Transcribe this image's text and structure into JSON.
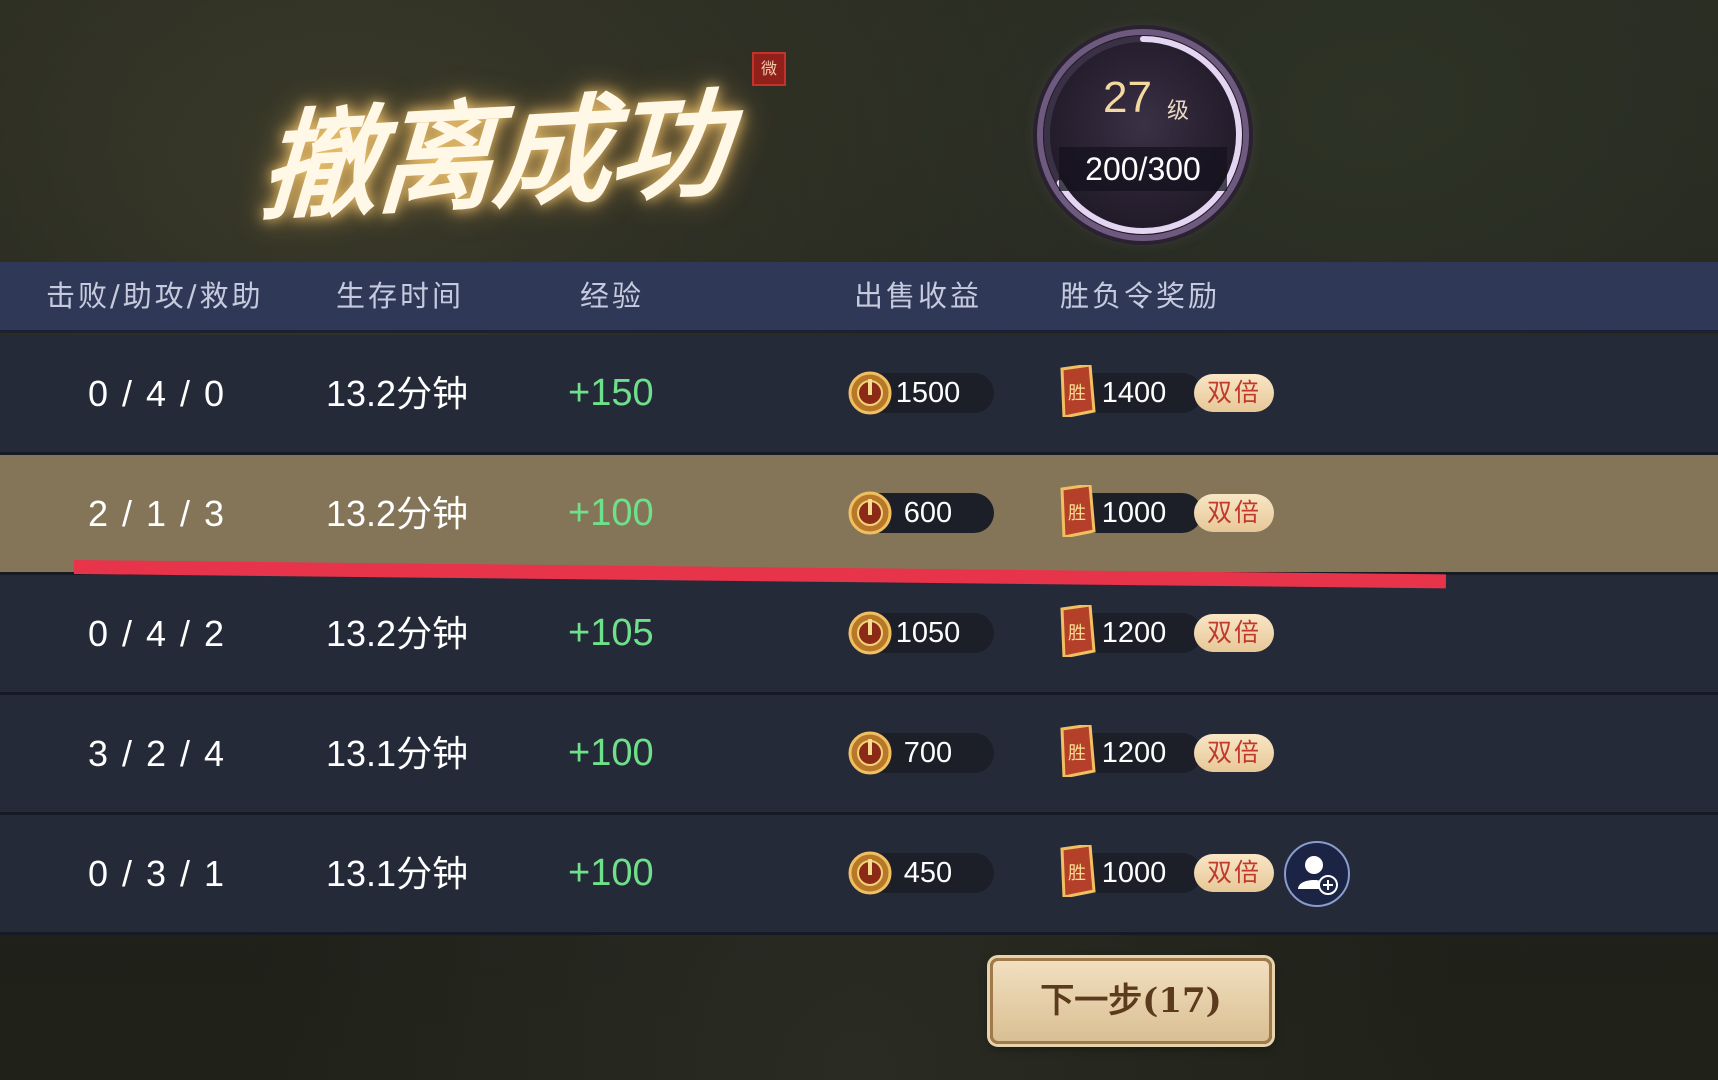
{
  "title": {
    "text": "撤离成功",
    "seal": "微"
  },
  "level": {
    "value": "27",
    "unit": "级",
    "exp": "200/300",
    "exp_fraction": 0.6667
  },
  "table": {
    "headers": [
      "击败/助攻/救助",
      "生存时间",
      "经验",
      "出售收益",
      "胜负令奖励"
    ],
    "rows": [
      {
        "kda": "0 / 4 / 0",
        "time": "13.2分钟",
        "exp": "+150",
        "gold": "1500",
        "ticket": "1400",
        "double": "双倍",
        "highlight": false,
        "add_friend": false
      },
      {
        "kda": "2 / 1 / 3",
        "time": "13.2分钟",
        "exp": "+100",
        "gold": "600",
        "ticket": "1000",
        "double": "双倍",
        "highlight": true,
        "add_friend": false
      },
      {
        "kda": "0 / 4 / 2",
        "time": "13.2分钟",
        "exp": "+105",
        "gold": "1050",
        "ticket": "1200",
        "double": "双倍",
        "highlight": false,
        "add_friend": false
      },
      {
        "kda": "3 / 2 / 4",
        "time": "13.1分钟",
        "exp": "+100",
        "gold": "700",
        "ticket": "1200",
        "double": "双倍",
        "highlight": false,
        "add_friend": false
      },
      {
        "kda": "0 / 3 / 1",
        "time": "13.1分钟",
        "exp": "+100",
        "gold": "450",
        "ticket": "1000",
        "double": "双倍",
        "highlight": false,
        "add_friend": true
      }
    ],
    "ticket_icon_char": "胜"
  },
  "icons": {
    "coin": "coin-icon",
    "ticket": "victory-token-icon",
    "add_friend": "add-friend-icon"
  },
  "colors": {
    "exp_green": "#6fe08a",
    "highlight_row": "#847559",
    "annotation_line": "#e8344b",
    "header_bg": "#2f3856"
  },
  "next_button": {
    "label": "下一步(17)"
  }
}
